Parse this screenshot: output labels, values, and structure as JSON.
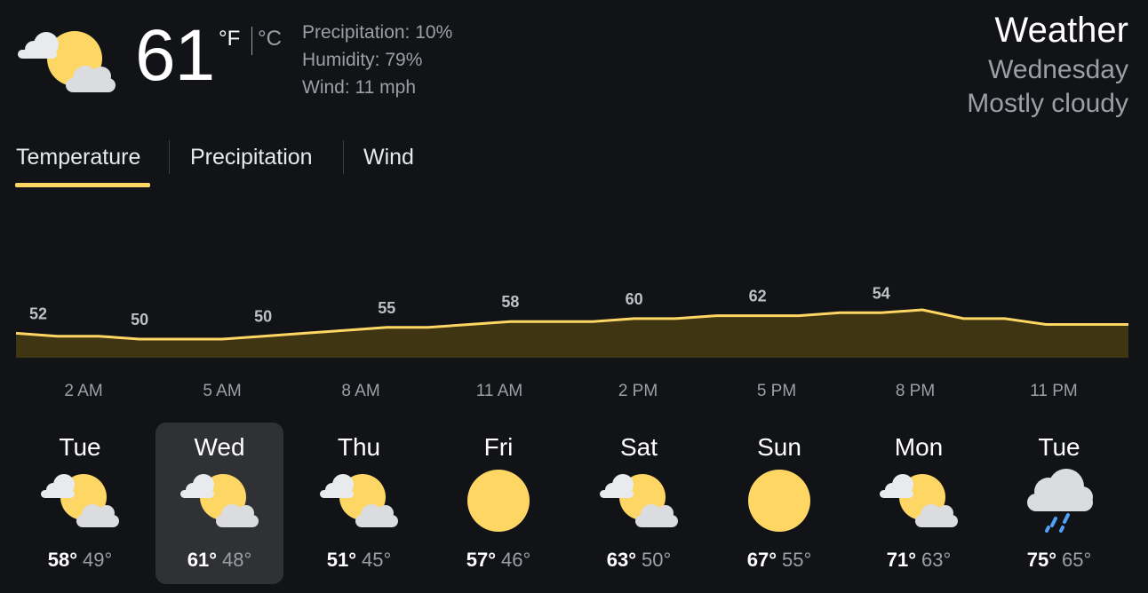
{
  "header": {
    "icon": "partly-cloudy-icon",
    "temperature": "61",
    "unit_f": "°F",
    "unit_c": "°C",
    "details": [
      "Precipitation: 10%",
      "Humidity: 79%",
      "Wind: 11 mph"
    ],
    "title": "Weather",
    "day": "Wednesday",
    "condition": "Mostly cloudy"
  },
  "tabs": [
    {
      "label": "Temperature",
      "selected": true
    },
    {
      "label": "Precipitation",
      "selected": false
    },
    {
      "label": "Wind",
      "selected": false
    }
  ],
  "colors": {
    "accent": "#fdd663",
    "fill": "#3f3512",
    "background": "#121317"
  },
  "chart_data": {
    "type": "area",
    "x_labels": [
      "2 AM",
      "5 AM",
      "8 AM",
      "11 AM",
      "2 PM",
      "5 PM",
      "8 PM",
      "11 PM"
    ],
    "hourly_values": [
      52,
      51,
      51,
      50,
      50,
      50,
      51,
      52,
      53,
      54,
      54,
      55,
      56,
      56,
      56,
      57,
      57,
      58,
      58,
      58,
      59,
      59,
      60,
      57,
      57,
      55,
      55,
      55
    ],
    "labels": [
      "52",
      "50",
      "50",
      "55",
      "58",
      "60",
      "62",
      "54"
    ],
    "label_indices": [
      0,
      3,
      6,
      9,
      12,
      15,
      18,
      21
    ]
  },
  "forecast": [
    {
      "day": "Tue",
      "icon": "partly-cloudy-icon",
      "high": "58°",
      "low": "49°",
      "selected": false
    },
    {
      "day": "Wed",
      "icon": "partly-cloudy-icon",
      "high": "61°",
      "low": "48°",
      "selected": true
    },
    {
      "day": "Thu",
      "icon": "partly-cloudy-icon",
      "high": "51°",
      "low": "45°",
      "selected": false
    },
    {
      "day": "Fri",
      "icon": "sunny-icon",
      "high": "57°",
      "low": "46°",
      "selected": false
    },
    {
      "day": "Sat",
      "icon": "partly-cloudy-icon",
      "high": "63°",
      "low": "50°",
      "selected": false
    },
    {
      "day": "Sun",
      "icon": "sunny-icon",
      "high": "67°",
      "low": "55°",
      "selected": false
    },
    {
      "day": "Mon",
      "icon": "partly-cloudy-icon",
      "high": "71°",
      "low": "63°",
      "selected": false
    },
    {
      "day": "Tue",
      "icon": "rain-icon",
      "high": "75°",
      "low": "65°",
      "selected": false
    }
  ]
}
